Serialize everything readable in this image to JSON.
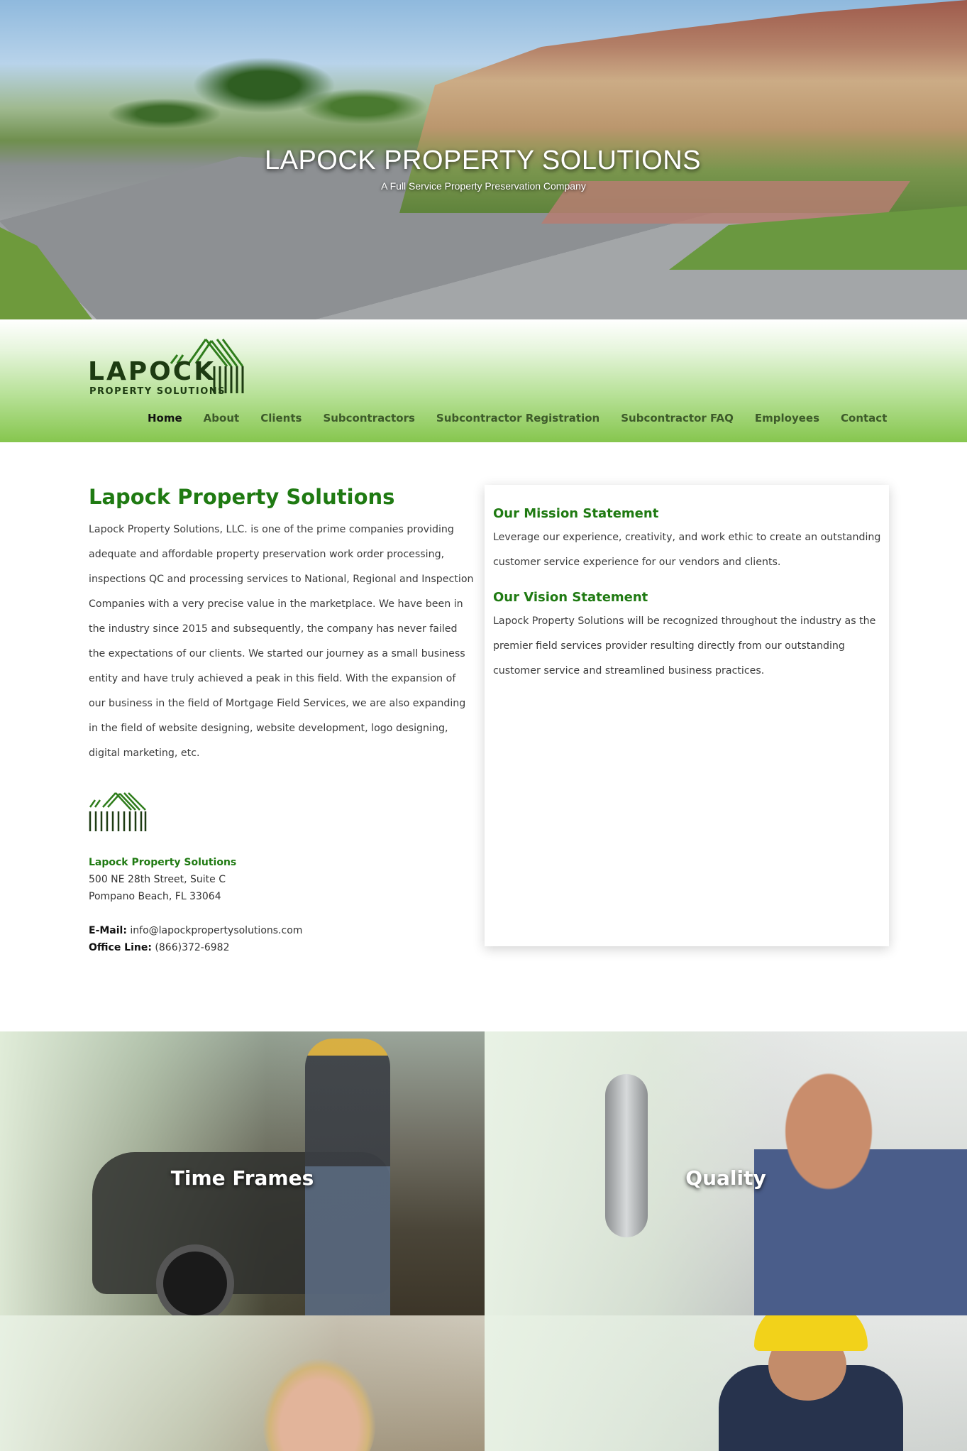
{
  "hero": {
    "title": "LAPOCK PROPERTY SOLUTIONS",
    "tagline": "A Full Service Property Preservation Company"
  },
  "logo": {
    "word": "LAPOCK",
    "sub": "PROPERTY SOLUTIONS"
  },
  "nav": {
    "items": [
      {
        "label": "Home",
        "active": true
      },
      {
        "label": "About"
      },
      {
        "label": "Clients"
      },
      {
        "label": "Subcontractors"
      },
      {
        "label": "Subcontractor Registration"
      },
      {
        "label": "Subcontractor FAQ"
      },
      {
        "label": "Employees"
      },
      {
        "label": "Contact"
      }
    ]
  },
  "about": {
    "heading": "Lapock Property Solutions",
    "body": "Lapock Property Solutions, LLC. is one of the prime companies providing adequate and affordable property preservation work order processing, inspections QC and processing services to National, Regional and Inspection Companies with a very precise value in the marketplace. We have been in the industry since 2015 and subsequently, the company has never failed the expectations of our clients. We started our journey as a small business entity and have truly achieved a peak in this field. With the expansion of our business in the field of Mortgage Field Services, we are also expanding in the field of website designing, website development, logo designing, digital marketing, etc."
  },
  "contact": {
    "company": "Lapock Property Solutions",
    "address_line1": "500 NE 28th Street, Suite C",
    "address_line2": "Pompano Beach, FL 33064",
    "email_label": "E-Mail:",
    "email": "info@lapockpropertysolutions.com",
    "phone_label": "Office Line:",
    "phone": "(866)372-6982"
  },
  "card": {
    "mission_title": "Our Mission Statement",
    "mission_body": "Leverage our experience, creativity, and work ethic to create an outstanding customer service experience for our vendors and clients.",
    "vision_title": "Our Vision Statement",
    "vision_body": "Lapock Property Solutions will be recognized throughout the industry as the premier field services provider resulting directly from our outstanding customer service and streamlined business practices."
  },
  "tiles": {
    "t1_label": "Time Frames",
    "t2_label": "Quality"
  },
  "colors": {
    "brand_green": "#1f7a12",
    "header_green": "#86c64e",
    "logo_dark": "#1d3b12"
  }
}
